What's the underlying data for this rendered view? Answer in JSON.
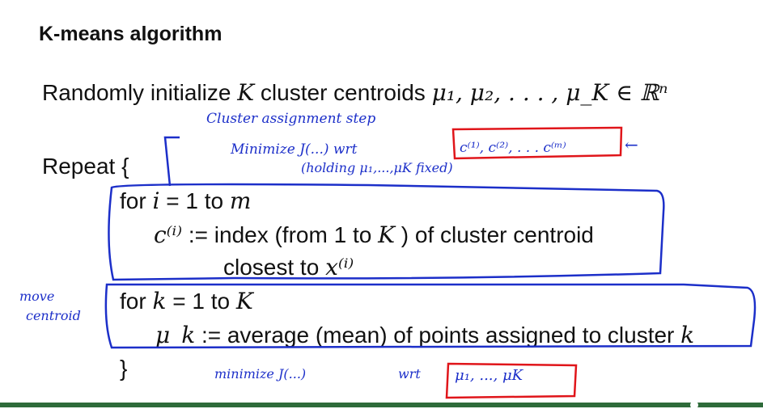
{
  "slide": {
    "title": "K-means algorithm",
    "init_line": {
      "text": "Randomly initialize",
      "var_K": "K",
      "text2": "cluster centroids",
      "math": "μ₁, μ₂, . . . , μ_K ∈ ℝⁿ"
    },
    "repeat_label": "Repeat {",
    "loop1": {
      "for_text": "for",
      "var": "i",
      "range": "= 1 to",
      "end": "m",
      "assign_lhs": "c⁽ⁱ⁾",
      "assign_text": ":= index (from 1 to",
      "assign_K": "K",
      "assign_text2": ") of cluster centroid",
      "closest_text": "closest to",
      "closest_var": "x⁽ⁱ⁾"
    },
    "loop2": {
      "for_text": "for",
      "var": "k",
      "range": "= 1 to",
      "end": "K",
      "assign_lhs": "μ_k",
      "assign_text": ":= average (mean) of points assigned to cluster",
      "assign_var": "k"
    },
    "close_brace": "}"
  },
  "annotations": {
    "cluster_step": "Cluster assignment step",
    "minimize_line": "Minimize J(...) wrt",
    "c_vars": "c⁽¹⁾, c⁽²⁾, . . . c⁽ᵐ⁾",
    "arrow": "←",
    "holding": "(holding μ₁,...,μK fixed)",
    "move_centroid_1": "move",
    "move_centroid_2": "centroid",
    "minimize_bottom": "minimize J(...)",
    "wrt_bottom": "wrt",
    "mu_vars": "μ₁, ..., μK"
  },
  "colors": {
    "ink_blue": "#1c2fc9",
    "ink_red": "#e0151a",
    "footer_green": "#2e6b3a"
  }
}
